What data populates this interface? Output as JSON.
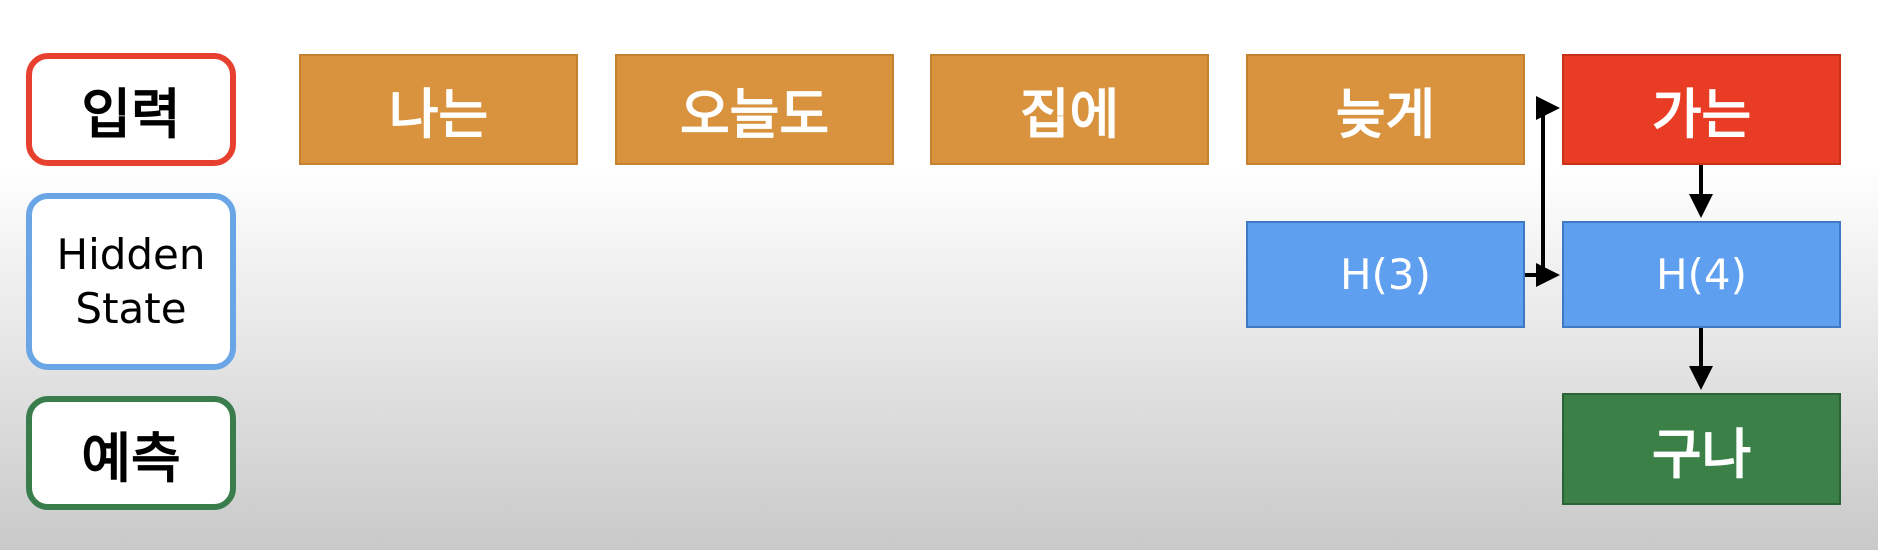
{
  "legend": {
    "input": "입력",
    "hidden": "Hidden\nState",
    "prediction": "예측"
  },
  "inputs": [
    "나는",
    "오늘도",
    "집에",
    "늦게",
    "가는"
  ],
  "hidden_states": [
    "H(3)",
    "H(4)"
  ],
  "prediction": "구나",
  "colors": {
    "input_word": "#d9933e",
    "current_input": "#e83c24",
    "hidden_state": "#5f9ff0",
    "prediction": "#3a8047",
    "legend_input_border": "#e8402e",
    "legend_hidden_border": "#6aa6e6",
    "legend_prediction_border": "#3a7d4c"
  }
}
